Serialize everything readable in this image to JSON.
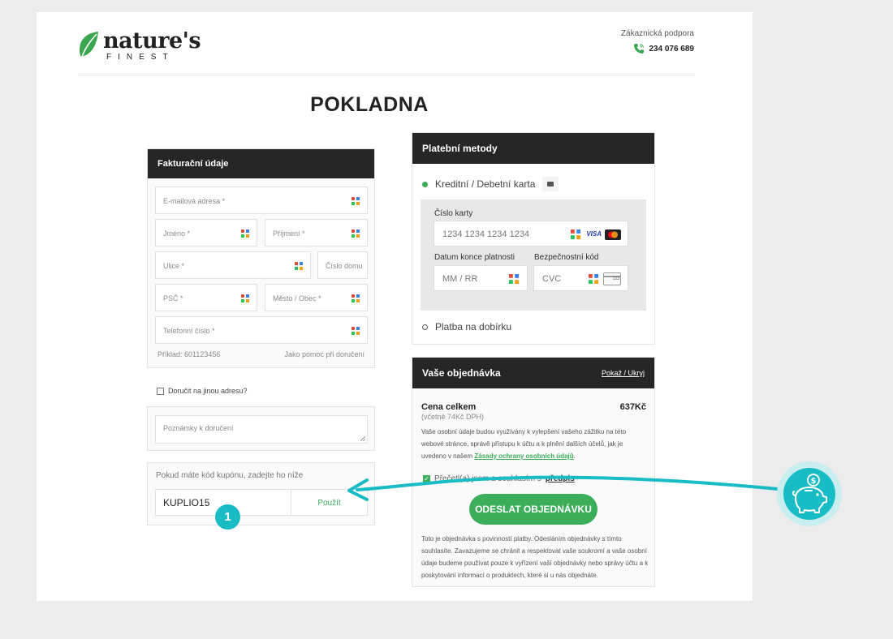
{
  "brand": {
    "name": "nature's",
    "sub": "FINEST"
  },
  "support": {
    "label": "Zákaznická podpora",
    "phone": "234 076 689"
  },
  "page_title": "POKLADNA",
  "billing": {
    "title": "Fakturační údaje",
    "email_placeholder": "E-mailová adresa *",
    "first_name_placeholder": "Jméno *",
    "last_name_placeholder": "Příjmení *",
    "street_placeholder": "Ulice *",
    "house_number_placeholder": "Číslo domu",
    "zip_placeholder": "PSČ *",
    "city_placeholder": "Město / Obec *",
    "phone_placeholder": "Telefonní číslo *",
    "phone_example": "Příklad: 601123456",
    "phone_note": "Jako pomoc při doručení",
    "ship_other_label": "Doručit na jinou adresu?",
    "notes_placeholder": "Poznámky k doručení"
  },
  "coupon": {
    "label": "Pokud máte kód kupónu, zadejte ho níže",
    "value": "KUPLIO15",
    "apply_label": "Použít",
    "badge": "1"
  },
  "payment": {
    "title": "Platební metody",
    "card_option": "Kreditní / Debetní karta",
    "card_number_label": "Číslo karty",
    "card_number_placeholder": "1234 1234 1234 1234",
    "visa": "VISA",
    "expiry_label": "Datum konce platnosti",
    "expiry_placeholder": "MM / RR",
    "cvc_label": "Bezpečnostní kód",
    "cvc_placeholder": "CVC",
    "cvc_digits": "123",
    "cod_option": "Platba na dobírku"
  },
  "order": {
    "title": "Vaše objednávka",
    "toggle_label": "Pokaž / Ukryj",
    "total_label": "Cena celkem",
    "vat_note": "(včetně 74Kč DPH)",
    "total_value": "637Kč",
    "privacy_text": "Vaše osobní údaje budou využívány k vylepšení vašeho zážitku na této webové stránce, správě přístupu k účtu a k plnění dalších účelů, jak je uvedeno v našem",
    "privacy_link": "Zásady ochrany osobních údajů",
    "privacy_end": ".",
    "terms_text": "Přečetl(a) jsem a souhlasím s",
    "terms_link": "předpis",
    "submit_label": "ODESLAT OBJEDNÁVKU",
    "disclaimer": "Toto je objednávka s povinností platby. Odesláním objednávky s tímto souhlasíte. Zavazujeme se chránit a respektovat vaše soukromí a vaše osobní údaje budeme používat pouze k vyřízení vaší objednávky nebo správy účtu a k poskytování informací o produktech, které si u nás objednáte."
  },
  "colors": {
    "accent_green": "#3cae5a",
    "teal": "#19bcc4",
    "dark_header": "#262626"
  },
  "icons": {
    "piggy_bank": "piggy-bank-coin-icon",
    "phone": "phone-icon",
    "autofill": "autofill-grid-icon"
  }
}
